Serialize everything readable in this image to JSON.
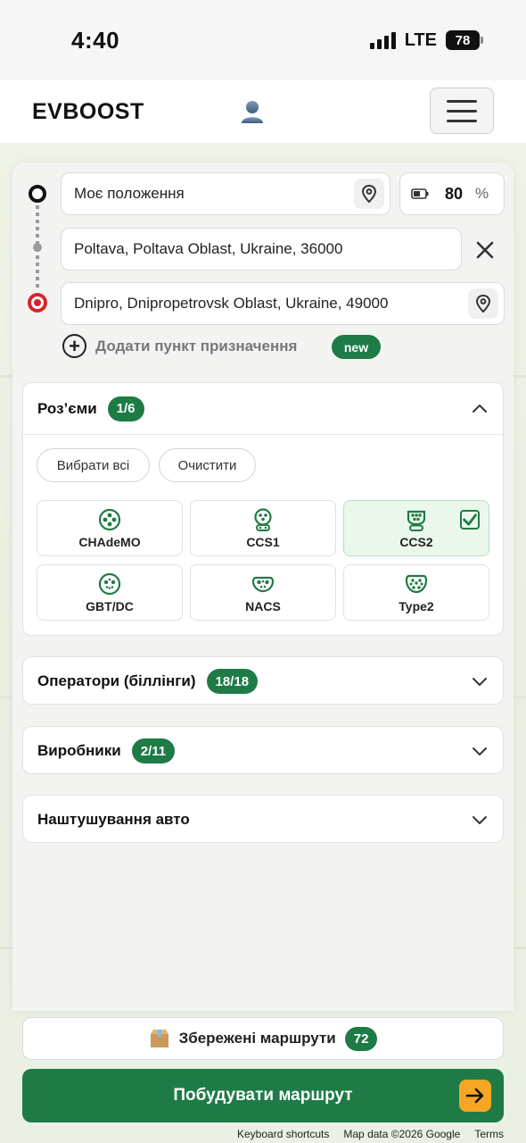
{
  "status_bar": {
    "time": "4:40",
    "network": "LTE",
    "battery": "78"
  },
  "header": {
    "brand": "EVBOOST"
  },
  "route": {
    "origin": "Моє положення",
    "battery_value": "80",
    "battery_unit": "%",
    "waypoint": "Poltava, Poltava Oblast, Ukraine, 36000",
    "destination": "Dnipro, Dnipropetrovsk Oblast, Ukraine, 49000",
    "add_destination": "Додати пункт призначення",
    "new_badge": "new"
  },
  "connectors": {
    "title": "Роз’єми",
    "count": "1/6",
    "select_all": "Вибрати всі",
    "clear": "Очистити",
    "items": [
      {
        "label": "CHAdeMO",
        "selected": false
      },
      {
        "label": "CCS1",
        "selected": false
      },
      {
        "label": "CCS2",
        "selected": true
      },
      {
        "label": "GBT/DC",
        "selected": false
      },
      {
        "label": "NACS",
        "selected": false
      },
      {
        "label": "Type2",
        "selected": false
      }
    ]
  },
  "operators": {
    "title": "Оператори (біллінги)",
    "count": "18/18"
  },
  "manufacturers": {
    "title": "Виробники",
    "count": "2/11"
  },
  "car_settings": {
    "title": "Наштушування авто"
  },
  "saved_routes": {
    "label": "Збережені маршрути",
    "count": "72"
  },
  "build_route": {
    "label": "Побудувати маршрут"
  },
  "map_footer": {
    "shortcuts": "Keyboard shortcuts",
    "map_data": "Map data ©2026 Google",
    "terms": "Terms"
  },
  "colors": {
    "accent": "#1e7b46",
    "arrow": "#f5a623"
  }
}
